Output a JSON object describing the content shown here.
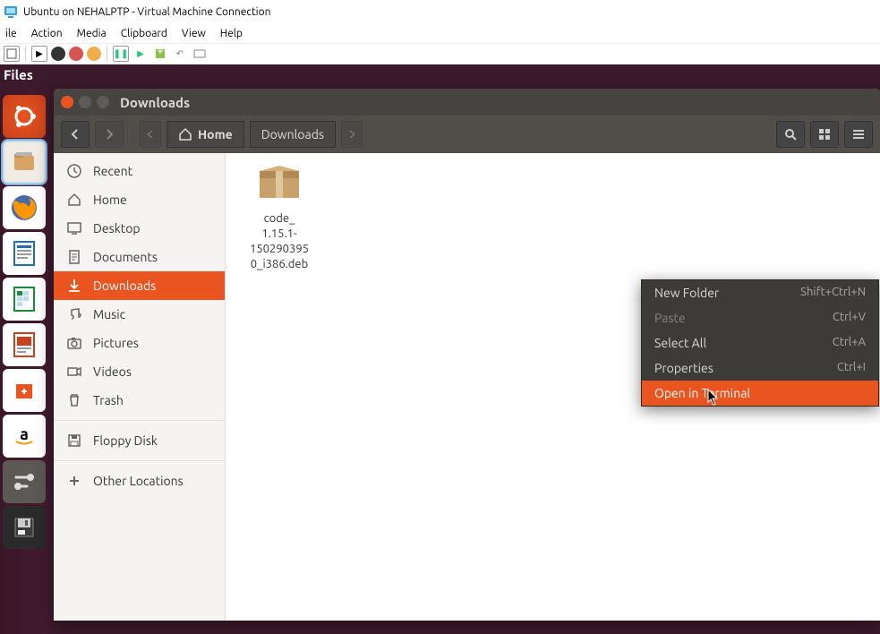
{
  "host": {
    "title": "Ubuntu on NEHALPTP - Virtual Machine Connection",
    "menu": [
      "ile",
      "Action",
      "Media",
      "Clipboard",
      "View",
      "Help"
    ]
  },
  "files_tab": "Files",
  "nautilus": {
    "title": "Downloads",
    "path": {
      "home": "Home",
      "current": "Downloads"
    },
    "sidebar": [
      {
        "icon": "clock",
        "label": "Recent"
      },
      {
        "icon": "home",
        "label": "Home"
      },
      {
        "icon": "desktop",
        "label": "Desktop"
      },
      {
        "icon": "doc",
        "label": "Documents"
      },
      {
        "icon": "download",
        "label": "Downloads",
        "active": true
      },
      {
        "icon": "music",
        "label": "Music"
      },
      {
        "icon": "camera",
        "label": "Pictures"
      },
      {
        "icon": "video",
        "label": "Videos"
      },
      {
        "icon": "trash",
        "label": "Trash"
      },
      {
        "sep": true
      },
      {
        "icon": "floppy",
        "label": "Floppy Disk"
      },
      {
        "sep": true
      },
      {
        "icon": "plus",
        "label": "Other Locations"
      }
    ],
    "file": {
      "name_l1": "code_",
      "name_l2": "1.15.1-",
      "name_l3": "150290395",
      "name_l4": "0_i386.deb"
    }
  },
  "context_menu": [
    {
      "label": "New Folder",
      "shortcut": "Shift+Ctrl+N"
    },
    {
      "label": "Paste",
      "shortcut": "Ctrl+V",
      "disabled": true
    },
    {
      "label": "Select All",
      "shortcut": "Ctrl+A"
    },
    {
      "label": "Properties",
      "shortcut": "Ctrl+I"
    },
    {
      "label": "Open in Terminal",
      "shortcut": "",
      "hover": true
    }
  ],
  "colors": {
    "accent": "#e95420",
    "dark": "#474341"
  }
}
